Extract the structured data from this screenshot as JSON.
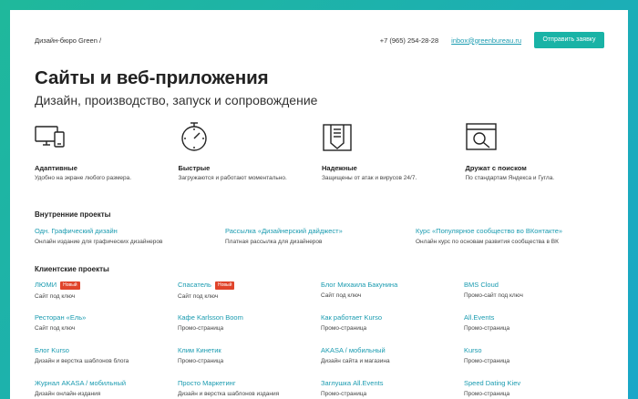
{
  "header": {
    "brand": "Дизайн-бюро Green /",
    "phone": "+7 (965) 254-28-28",
    "email": "inbox@greenbureau.ru",
    "cta_label": "Отправить заявку"
  },
  "hero": {
    "title": "Сайты и веб-приложения",
    "subtitle": "Дизайн, производство, запуск и сопровождение"
  },
  "features": [
    {
      "icon": "devices-icon",
      "title": "Адаптивные",
      "desc": "Удобно на экране любого размера."
    },
    {
      "icon": "stopwatch-icon",
      "title": "Быстрые",
      "desc": "Загружаются и работают моментально."
    },
    {
      "icon": "shield-document-icon",
      "title": "Надежные",
      "desc": "Защищены от атак и вирусов 24/7."
    },
    {
      "icon": "search-browser-icon",
      "title": "Дружат с поиском",
      "desc": "По стандартам Яндекса и Гугла."
    }
  ],
  "internal": {
    "title": "Внутренние проекты",
    "items": [
      {
        "name": "Одн. Графический дизайн",
        "desc": "Онлайн издание для графических дизайнеров"
      },
      {
        "name": "Рассылка «Дизайнерский дайджест»",
        "desc": "Платная рассылка для дизайнеров"
      },
      {
        "name": "Курс «Популярное сообщество во ВКонтакте»",
        "desc": "Онлайн курс по основам развития сообщества в ВК"
      }
    ]
  },
  "clients": {
    "title": "Клиентские проекты",
    "badge_label": "Новый",
    "items": [
      {
        "name": "ЛЮМИ",
        "desc": "Сайт под ключ",
        "badge": true
      },
      {
        "name": "Спасатель",
        "desc": "Сайт под ключ",
        "badge": true
      },
      {
        "name": "Блог Михаила Бакунина",
        "desc": "Сайт под ключ",
        "badge": false
      },
      {
        "name": "BMS Cloud",
        "desc": "Промо-сайт под ключ",
        "badge": false
      },
      {
        "name": "Ресторан «Ель»",
        "desc": "Сайт под ключ",
        "badge": false
      },
      {
        "name": "Кафе Karlsson Boom",
        "desc": "Промо-страница",
        "badge": false
      },
      {
        "name": "Как работает Kurso",
        "desc": "Промо-страница",
        "badge": false
      },
      {
        "name": "All.Events",
        "desc": "Промо-страница",
        "badge": false
      },
      {
        "name": "Блог Kurso",
        "desc": "Дизайн и верстка шаблонов блога",
        "badge": false
      },
      {
        "name": "Клим Кинетик",
        "desc": "Промо-страница",
        "badge": false
      },
      {
        "name": "AKASA / мобильный",
        "desc": "Дизайн сайта и магазина",
        "badge": false
      },
      {
        "name": "Kurso",
        "desc": "Промо-страница",
        "badge": false
      },
      {
        "name": "Журнал AKASA / мобильный",
        "desc": "Дизайн онлайн-издания",
        "badge": false
      },
      {
        "name": "Просто Маркетинг",
        "desc": "Дизайн и верстка шаблонов издания",
        "badge": false
      },
      {
        "name": "Заглушка All.Events",
        "desc": "Промо-страница",
        "badge": false
      },
      {
        "name": "Speed Dating Kiev",
        "desc": "Промо-страница",
        "badge": false
      }
    ]
  }
}
